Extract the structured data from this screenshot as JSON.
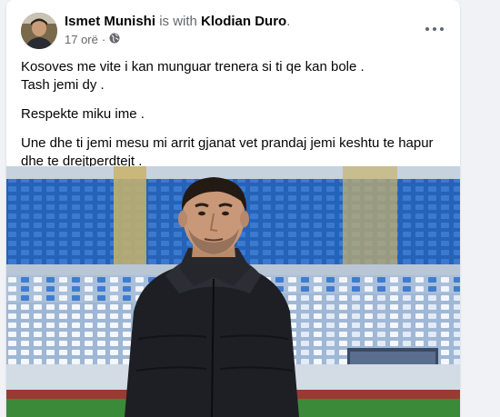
{
  "post": {
    "author": "Ismet Munishi",
    "with_text": "is with",
    "tagged": "Klodian Duro",
    "period": ".",
    "time": "17 orë",
    "separator": "·",
    "privacy_icon": "globe-icon",
    "more_icon": "more-options-icon",
    "lines": [
      "Kosoves me vite i kan munguar trenera si ti qe kan bole .",
      "Tash jemi dy .",
      "Respekte miku ime .",
      "Une dhe ti jemi mesu mi arrit gjanat vet prandaj jemi keshtu te hapur",
      "dhe te drejtperdtejt ."
    ]
  },
  "colors": {
    "stadium_seat_blue": "#1f5fb5",
    "pitch_green": "#3a8a3a",
    "track_red": "#9b3a32"
  }
}
